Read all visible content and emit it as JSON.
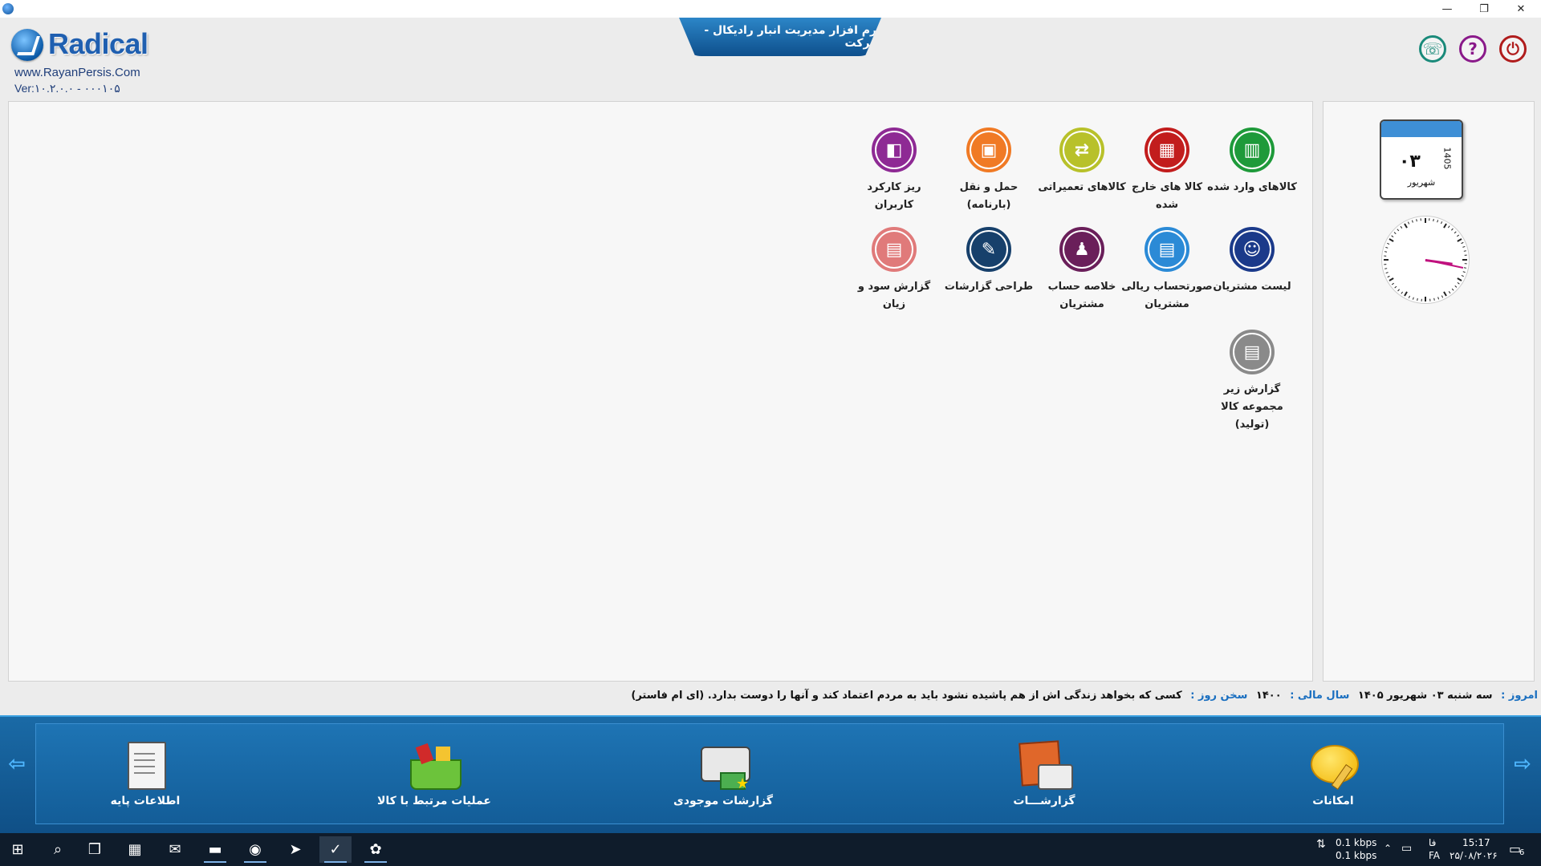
{
  "window": {
    "title_banner": "نرم افزار مدیریت انبار رادیکال - شرکت",
    "controls": {
      "minimize": "—",
      "maximize": "❐",
      "close": "✕"
    }
  },
  "header": {
    "logo_text": "Radical",
    "website": "www.RayanPersis.Com",
    "version": "Ver:۱۰.۲.۰.۰ - ۰۰۰۱۰۵",
    "icons": {
      "phone": "☏",
      "help": "?",
      "exit": "⏻"
    }
  },
  "menu": {
    "tiles": [
      {
        "label": "کالاهای وارد شده",
        "icon": "chart-icon",
        "color": "#1e9a3a",
        "glyph": "▥"
      },
      {
        "label": "کالا های خارج شده",
        "icon": "exit-chart-icon",
        "color": "#c21d1d",
        "glyph": "▦"
      },
      {
        "label": "کالاهای تعمیراتی",
        "icon": "shuffle-icon",
        "color": "#b8c12a",
        "glyph": "⇄"
      },
      {
        "label": "حمل و نقل (بارنامه)",
        "icon": "bus-icon",
        "color": "#f07a25",
        "glyph": "▣"
      },
      {
        "label": "ریز کارکرد کاربران",
        "icon": "user-activity-icon",
        "color": "#8e2a94",
        "glyph": "◧"
      },
      {
        "label": "لیست مشتریان",
        "icon": "customer-icon",
        "color": "#1b3a8a",
        "glyph": "☺"
      },
      {
        "label": "صورتحساب ریالی مشتریان",
        "icon": "invoice-icon",
        "color": "#2b8ad6",
        "glyph": "▤"
      },
      {
        "label": "خلاصه حساب مشتریان",
        "icon": "manager-icon",
        "color": "#6a1f5a",
        "glyph": "♟"
      },
      {
        "label": "طراحی گزارشات",
        "icon": "report-design-icon",
        "color": "#17406b",
        "glyph": "✎"
      },
      {
        "label": "گزارش سود و زیان",
        "icon": "profit-report-icon",
        "color": "#e07a7a",
        "glyph": "▤"
      },
      {
        "label": "گزارش زیر مجموعه کالا (تولید)",
        "icon": "sub-product-report-icon",
        "color": "#8a8a8a",
        "glyph": "▤"
      }
    ]
  },
  "calendar": {
    "day": "۰۳",
    "year": "1405",
    "month": "شهریور"
  },
  "info_line": {
    "today_label": "امروز :",
    "today_value": "سه شنبه ۰۳ شهریور ۱۴۰۵",
    "fiscal_label": "سال مالی :",
    "fiscal_value": "۱۴۰۰",
    "quote_label": "سخن روز :",
    "quote_value": "کسی که بخواهد زندگی اش از هم پاشیده نشود باید به مردم اعتماد کند و آنها را دوست بدارد. (ای ام فاستر)"
  },
  "ribbon": {
    "items": [
      {
        "label": "امکانات",
        "icon": "speech-bubble-icon"
      },
      {
        "label": "گزارشـــات",
        "icon": "printer-report-icon"
      },
      {
        "label": "گزارشات موجودی",
        "icon": "inventory-printer-icon"
      },
      {
        "label": "عملیات مرتبط با کالا",
        "icon": "basket-icon"
      },
      {
        "label": "اطلاعات پایه",
        "icon": "document-icon"
      }
    ]
  },
  "taskbar": {
    "net_down": "0.1 kbps",
    "net_up": "0.1 kbps",
    "lang_top": "فا",
    "lang": "FA",
    "time": "15:17",
    "date": "۲۵/۰۸/۲۰۲۶",
    "notif_count": "6"
  }
}
